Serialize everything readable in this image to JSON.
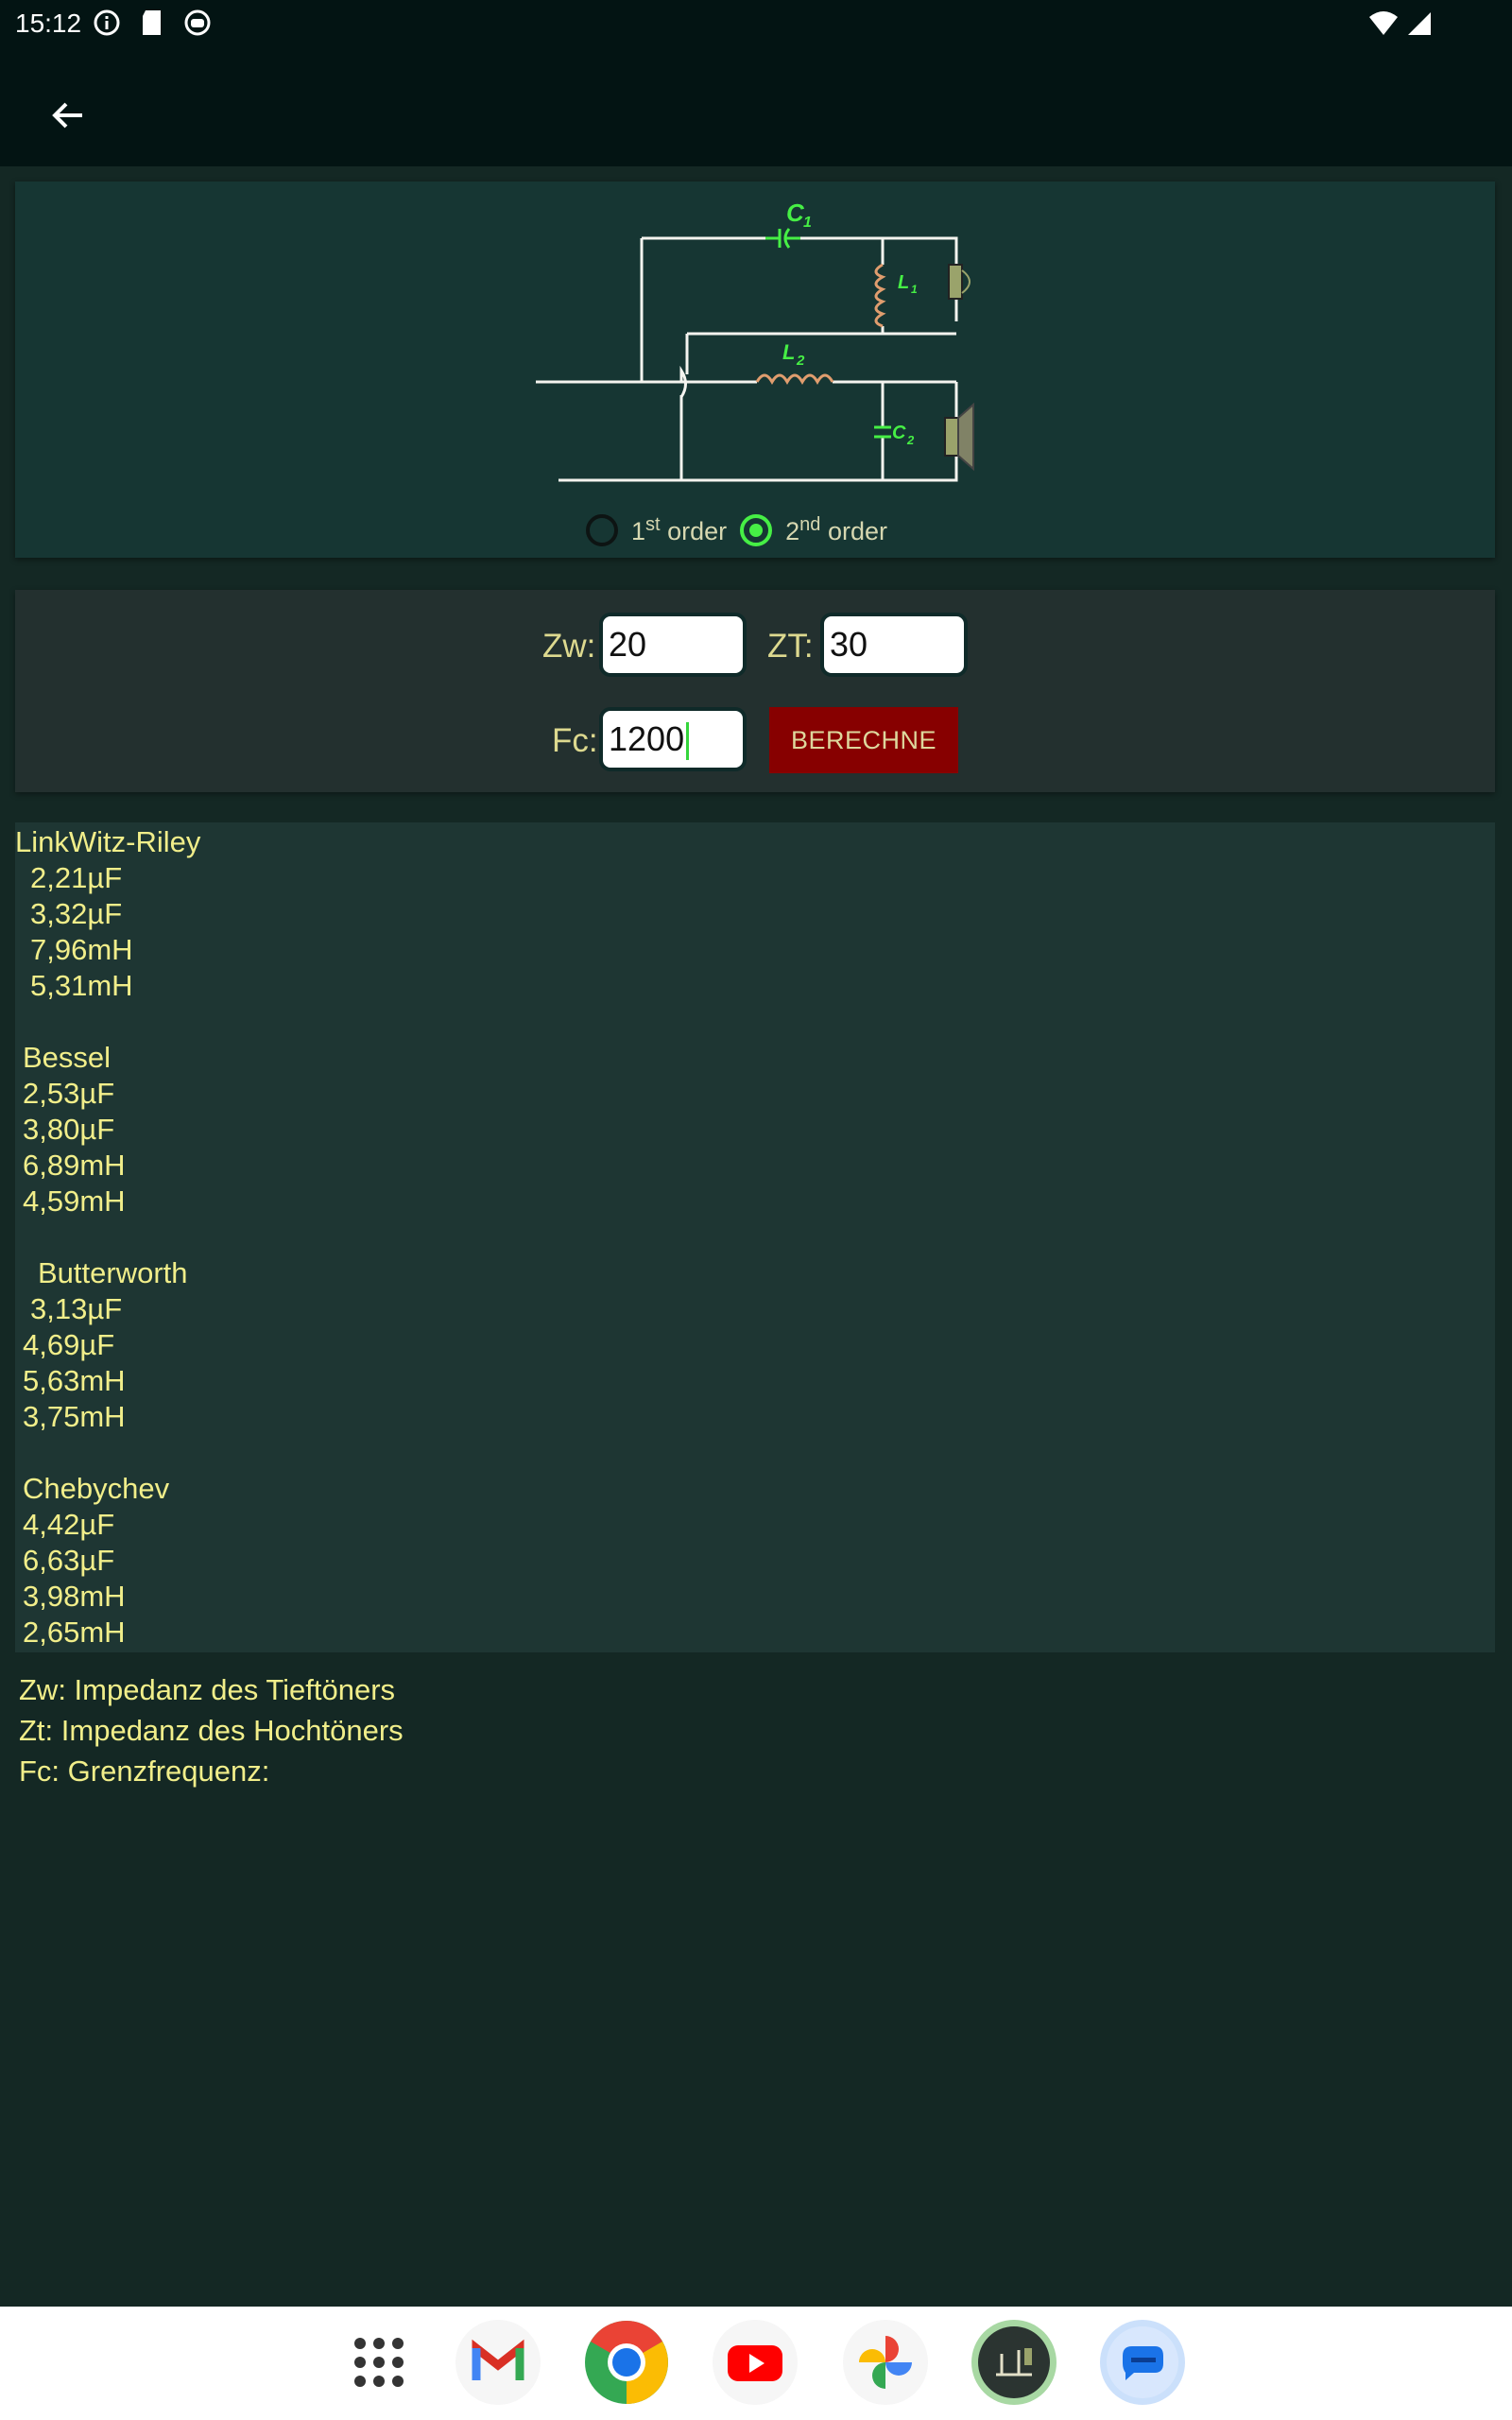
{
  "status_bar": {
    "time": "15:12"
  },
  "diagram": {
    "labels": {
      "c1": "C",
      "c1_sub": "1",
      "l1": "L",
      "l1_sub": "1",
      "l2": "L",
      "l2_sub": "2",
      "c2": "C",
      "c2_sub": "2"
    },
    "order_options": [
      {
        "number": "1",
        "suffix": "st",
        "word": "order",
        "selected": false
      },
      {
        "number": "2",
        "suffix": "nd",
        "word": "order",
        "selected": true
      }
    ]
  },
  "form": {
    "zw_label": "Zw:",
    "zw_value": "20",
    "zt_label": "ZT:",
    "zt_value": "30",
    "fc_label": "Fc:",
    "fc_value": "1200",
    "calculate_label": "BERECHNE"
  },
  "results": [
    {
      "name": "LinkWitz-Riley",
      "values": [
        "2,21µF",
        "3,32µF",
        "7,96mH",
        "5,31mH"
      ]
    },
    {
      "name": "Bessel",
      "values": [
        "2,53µF",
        "3,80µF",
        "6,89mH",
        "4,59mH"
      ]
    },
    {
      "name": "Butterworth",
      "values": [
        "3,13µF",
        "4,69µF",
        "5,63mH",
        "3,75mH"
      ]
    },
    {
      "name": "Chebychev",
      "values": [
        "4,42µF",
        "6,63µF",
        "3,98mH",
        "2,65mH"
      ]
    }
  ],
  "legend": [
    "Zw: Impedanz des Tieftöners",
    "Zt: Impedanz des Hochtöners",
    "Fc: Grenzfrequenz:"
  ],
  "dock": [
    "apps-grid-icon",
    "gmail-icon",
    "chrome-icon",
    "youtube-icon",
    "photos-icon",
    "crossover-app-icon",
    "messages-icon"
  ]
}
